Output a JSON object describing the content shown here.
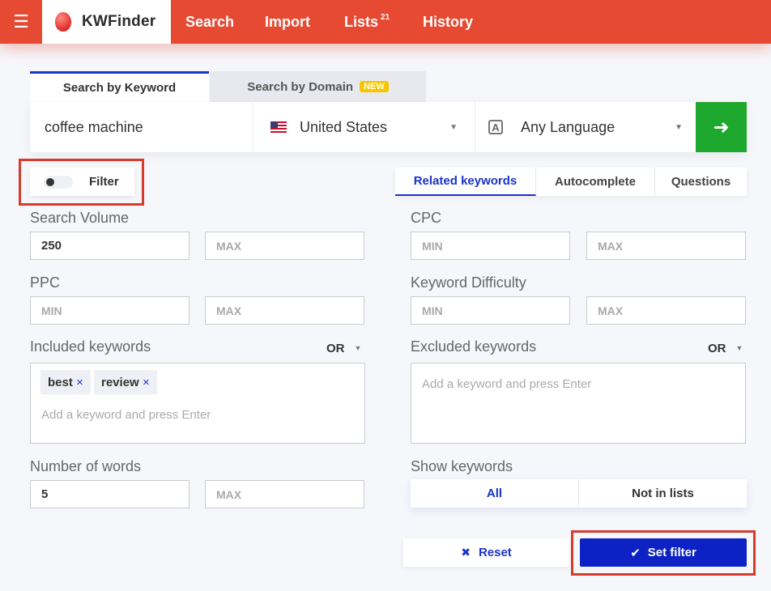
{
  "nav": {
    "brand": "KWFinder",
    "items": [
      {
        "label": "Search"
      },
      {
        "label": "Import"
      },
      {
        "label": "Lists",
        "badge": "21"
      },
      {
        "label": "History"
      }
    ]
  },
  "search": {
    "tabs": [
      {
        "label": "Search by Keyword",
        "active": true
      },
      {
        "label": "Search by Domain",
        "badge": "NEW"
      }
    ],
    "keyword": "coffee machine",
    "country": "United States",
    "language": "Any Language"
  },
  "filter_toggle": {
    "label": "Filter",
    "on": false
  },
  "keyword_tabs": [
    {
      "label": "Related keywords",
      "active": true
    },
    {
      "label": "Autocomplete"
    },
    {
      "label": "Questions"
    }
  ],
  "filters": {
    "search_volume": {
      "label": "Search Volume",
      "min": "250",
      "max_placeholder": "MAX"
    },
    "cpc": {
      "label": "CPC",
      "min_placeholder": "MIN",
      "max_placeholder": "MAX"
    },
    "ppc": {
      "label": "PPC",
      "min_placeholder": "MIN",
      "max_placeholder": "MAX"
    },
    "keyword_difficulty": {
      "label": "Keyword Difficulty",
      "min_placeholder": "MIN",
      "max_placeholder": "MAX"
    },
    "included": {
      "label": "Included keywords",
      "operator": "OR",
      "tags": [
        "best",
        "review"
      ],
      "placeholder": "Add a keyword and press Enter"
    },
    "excluded": {
      "label": "Excluded keywords",
      "operator": "OR",
      "tags": [],
      "placeholder": "Add a keyword and press Enter"
    },
    "number_of_words": {
      "label": "Number of words",
      "min": "5",
      "max_placeholder": "MAX"
    },
    "show_keywords": {
      "label": "Show keywords",
      "options": [
        "All",
        "Not in lists"
      ],
      "selected": "All"
    }
  },
  "actions": {
    "reset": "Reset",
    "set_filter": "Set filter"
  },
  "colors": {
    "brand_red": "#e64a33",
    "accent_blue": "#1a33c9",
    "go_green": "#1fa82e",
    "highlight_red": "#d63b2c"
  }
}
